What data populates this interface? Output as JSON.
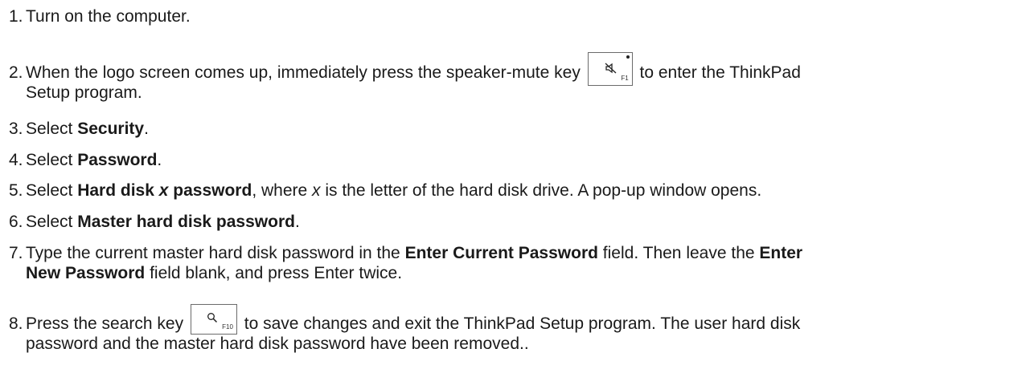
{
  "steps": [
    {
      "num": "1.",
      "text": "Turn on the computer."
    },
    {
      "num": "2.",
      "before_key": "When the logo screen comes up, immediately press the speaker-mute key",
      "key_label": "F1",
      "key_icon": "speaker-mute-icon",
      "after_key": " to enter the ThinkPad",
      "line2": "Setup program."
    },
    {
      "num": "3.",
      "prefix": "Select ",
      "bold": "Security",
      "suffix": "."
    },
    {
      "num": "4.",
      "prefix": "Select ",
      "bold": "Password",
      "suffix": "."
    },
    {
      "num": "5.",
      "prefix": "Select ",
      "bold1": "Hard disk ",
      "bold_italic": "x",
      "bold2": " password",
      "mid": ", where ",
      "italic": "x",
      "suffix": " is the letter of the hard disk drive. A pop-up window opens."
    },
    {
      "num": "6.",
      "prefix": "Select ",
      "bold": "Master hard disk password",
      "suffix": "."
    },
    {
      "num": "7.",
      "prefix": "Type the current master hard disk password in the ",
      "bold1": "Enter Current Password",
      "mid": " field. Then leave the ",
      "bold2a": "Enter",
      "bold2b": "New Password",
      "suffix": " field blank, and press Enter twice."
    },
    {
      "num": "8.",
      "before_key": "Press the search key",
      "key_label": "F10",
      "key_icon": "search-icon",
      "after_key": " to save changes and exit the ThinkPad Setup program. The user hard disk",
      "line2": "password and the master hard disk password have been removed.."
    }
  ]
}
